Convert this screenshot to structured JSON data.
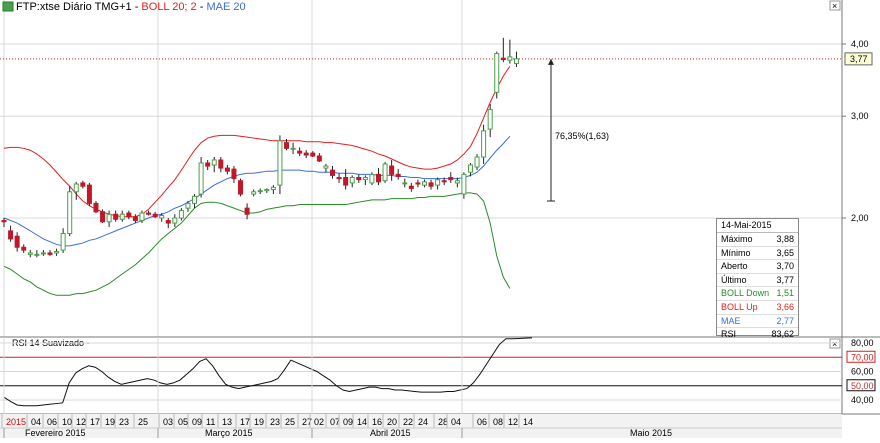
{
  "main_title": {
    "icon": "chart-settings-icon",
    "symbol": "FTP:xtse Diário TMG+1",
    "boll": "BOLL 20; 2",
    "mae": "MAE 20",
    "sep": "-"
  },
  "rsi_title": "RSI 14 Suavizado",
  "rsi_sep": "-",
  "close_icon": "close-icon",
  "colors": {
    "up": "#4aa04a",
    "down": "#c0182a",
    "boll_up": "#e02020",
    "boll_down": "#2a8a2a",
    "mae": "#3a6fd8",
    "grid": "#d8d8d8",
    "hline": "#e02020",
    "rsi": "#111111",
    "rsi70": "#d02020"
  },
  "main_axis": {
    "labels": [
      "4,00",
      "3,00",
      "2,00"
    ],
    "current": "3,77"
  },
  "rsi_axis": {
    "labels": [
      "80,00",
      "70,00",
      "60,00",
      "50,00",
      "40,00"
    ],
    "boxed": [
      "70,00",
      "50,00"
    ]
  },
  "annotation": "76,35%(1,63)",
  "info": {
    "date": "14-Mai-2015",
    "rows": [
      {
        "k": "Máximo",
        "v": "3,88",
        "color": "#000000"
      },
      {
        "k": "Mínimo",
        "v": "3,65",
        "color": "#000000"
      },
      {
        "k": "Aberto",
        "v": "3,70",
        "color": "#000000"
      },
      {
        "k": "Último",
        "v": "3,77",
        "color": "#000000"
      },
      {
        "k": "BOLL Down",
        "v": "1,51",
        "color": "#2a8a2a"
      },
      {
        "k": "BOLL Up",
        "v": "3,66",
        "color": "#e02020"
      },
      {
        "k": "MAE",
        "v": "2,77",
        "color": "#3a6fd8"
      },
      {
        "k": "RSI",
        "v": "83,62",
        "color": "#000000"
      }
    ]
  },
  "x_axis": {
    "days": [
      "2015",
      "04",
      "06",
      "10",
      "12",
      "17",
      "19",
      "23",
      "25",
      "03",
      "05",
      "09",
      "11",
      "13",
      "17",
      "19",
      "23",
      "25",
      "27",
      "02",
      "07",
      "09",
      "14",
      "16",
      "20",
      "22",
      "24",
      "28",
      "04",
      "06",
      "08",
      "12",
      "14"
    ],
    "months": [
      "Fevereiro 2015",
      "Março 2015",
      "Abril 2015",
      "Maio 2015"
    ]
  },
  "chart_data": {
    "type": "candlestick",
    "title": "FTP:xtse Diário TMG+1",
    "y_range": [
      1.0,
      4.3
    ],
    "y_ticks": [
      4.0,
      3.0,
      2.0
    ],
    "last_value": 3.77,
    "annotation": {
      "text": "76,35%(1,63)",
      "from": 2.14,
      "to": 3.77
    },
    "series": [
      {
        "name": "Candles",
        "ohlc": [
          [
            1.98,
            2.0,
            1.93,
            1.97
          ],
          [
            1.9,
            1.94,
            1.82,
            1.84
          ],
          [
            1.86,
            1.89,
            1.75,
            1.78
          ],
          [
            1.78,
            1.8,
            1.74,
            1.76
          ],
          [
            1.73,
            1.76,
            1.71,
            1.74
          ],
          [
            1.73,
            1.76,
            1.71,
            1.73
          ],
          [
            1.74,
            1.76,
            1.72,
            1.74
          ],
          [
            1.74,
            1.76,
            1.72,
            1.73
          ],
          [
            1.74,
            1.77,
            1.72,
            1.75
          ],
          [
            1.76,
            1.92,
            1.74,
            1.88
          ],
          [
            1.88,
            2.27,
            1.86,
            2.22
          ],
          [
            2.22,
            2.31,
            2.15,
            2.29
          ],
          [
            2.3,
            2.32,
            2.25,
            2.27
          ],
          [
            2.28,
            2.3,
            2.1,
            2.12
          ],
          [
            2.12,
            2.14,
            2.04,
            2.05
          ],
          [
            2.05,
            2.07,
            1.96,
            1.97
          ],
          [
            1.97,
            2.06,
            1.93,
            2.03
          ],
          [
            2.03,
            2.06,
            1.97,
            1.99
          ],
          [
            1.99,
            2.06,
            1.97,
            2.03
          ],
          [
            2.04,
            2.06,
            1.99,
            2.01
          ],
          [
            2.01,
            2.03,
            1.96,
            1.98
          ],
          [
            1.98,
            2.06,
            1.96,
            2.04
          ],
          [
            2.04,
            2.06,
            2.02,
            2.03
          ],
          [
            2.03,
            2.05,
            2.0,
            2.01
          ],
          [
            2.0,
            2.04,
            1.97,
            2.02
          ],
          [
            1.98,
            2.0,
            1.92,
            1.96
          ],
          [
            1.96,
            2.03,
            1.93,
            2.0
          ],
          [
            2.0,
            2.08,
            1.98,
            2.06
          ],
          [
            2.08,
            2.14,
            2.05,
            2.12
          ],
          [
            2.12,
            2.2,
            2.08,
            2.18
          ],
          [
            2.2,
            2.55,
            2.17,
            2.49
          ],
          [
            2.49,
            2.52,
            2.42,
            2.46
          ],
          [
            2.47,
            2.55,
            2.4,
            2.52
          ],
          [
            2.52,
            2.55,
            2.4,
            2.44
          ],
          [
            2.44,
            2.47,
            2.38,
            2.41
          ],
          [
            2.43,
            2.46,
            2.3,
            2.34
          ],
          [
            2.32,
            2.34,
            2.18,
            2.2
          ],
          [
            2.08,
            2.12,
            1.99,
            2.03
          ],
          [
            2.2,
            2.24,
            2.18,
            2.22
          ],
          [
            2.23,
            2.25,
            2.2,
            2.23
          ],
          [
            2.23,
            2.25,
            2.21,
            2.24
          ],
          [
            2.24,
            2.28,
            2.2,
            2.26
          ],
          [
            2.28,
            2.78,
            2.2,
            2.72
          ],
          [
            2.7,
            2.74,
            2.62,
            2.64
          ],
          [
            2.64,
            2.7,
            2.58,
            2.64
          ],
          [
            2.61,
            2.65,
            2.56,
            2.59
          ],
          [
            2.59,
            2.62,
            2.54,
            2.57
          ],
          [
            2.59,
            2.61,
            2.55,
            2.56
          ],
          [
            2.56,
            2.59,
            2.5,
            2.51
          ],
          [
            2.44,
            2.48,
            2.4,
            2.46
          ],
          [
            2.42,
            2.46,
            2.34,
            2.37
          ],
          [
            2.35,
            2.39,
            2.3,
            2.34
          ],
          [
            2.35,
            2.43,
            2.24,
            2.28
          ],
          [
            2.3,
            2.37,
            2.26,
            2.35
          ],
          [
            2.35,
            2.38,
            2.3,
            2.33
          ],
          [
            2.33,
            2.37,
            2.28,
            2.35
          ],
          [
            2.3,
            2.4,
            2.28,
            2.38
          ],
          [
            2.38,
            2.44,
            2.28,
            2.31
          ],
          [
            2.32,
            2.5,
            2.3,
            2.48
          ],
          [
            2.46,
            2.52,
            2.32,
            2.38
          ],
          [
            2.38,
            2.43,
            2.33,
            2.36
          ],
          [
            2.3,
            2.34,
            2.26,
            2.3
          ],
          [
            2.27,
            2.3,
            2.22,
            2.25
          ],
          [
            2.3,
            2.33,
            2.26,
            2.29
          ],
          [
            2.28,
            2.33,
            2.26,
            2.31
          ],
          [
            2.3,
            2.33,
            2.24,
            2.27
          ],
          [
            2.28,
            2.35,
            2.24,
            2.33
          ],
          [
            2.32,
            2.35,
            2.28,
            2.31
          ],
          [
            2.35,
            2.4,
            2.3,
            2.33
          ],
          [
            2.3,
            2.35,
            2.26,
            2.32
          ],
          [
            2.2,
            2.4,
            2.16,
            2.38
          ],
          [
            2.4,
            2.49,
            2.36,
            2.47
          ],
          [
            2.45,
            2.58,
            2.42,
            2.55
          ],
          [
            2.55,
            2.9,
            2.48,
            2.83
          ],
          [
            2.85,
            3.15,
            2.76,
            3.08
          ],
          [
            3.3,
            3.88,
            3.22,
            3.85
          ],
          [
            3.78,
            4.1,
            3.72,
            3.76
          ],
          [
            3.75,
            4.07,
            3.7,
            3.8
          ],
          [
            3.7,
            3.88,
            3.65,
            3.77
          ]
        ]
      },
      {
        "name": "BOLL Up",
        "values": [
          2.64,
          2.65,
          2.65,
          2.64,
          2.62,
          2.58,
          2.53,
          2.47,
          2.4,
          2.33,
          2.27,
          2.2,
          2.14,
          2.1,
          2.07,
          2.05,
          2.03,
          2.02,
          2.01,
          2.01,
          2.01,
          2.03,
          2.07,
          2.13,
          2.19,
          2.26,
          2.33,
          2.42,
          2.52,
          2.62,
          2.7,
          2.75,
          2.77,
          2.78,
          2.78,
          2.78,
          2.77,
          2.76,
          2.75,
          2.74,
          2.73,
          2.72,
          2.72,
          2.72,
          2.72,
          2.72,
          2.71,
          2.71,
          2.71,
          2.7,
          2.7,
          2.69,
          2.68,
          2.67,
          2.65,
          2.63,
          2.61,
          2.58,
          2.56,
          2.53,
          2.5,
          2.47,
          2.45,
          2.44,
          2.43,
          2.43,
          2.44,
          2.46,
          2.48,
          2.52,
          2.58,
          2.66,
          2.8,
          2.98,
          3.17,
          3.35,
          3.52,
          3.66
        ]
      },
      {
        "name": "BOLL Down",
        "values": [
          1.65,
          1.63,
          1.6,
          1.57,
          1.55,
          1.52,
          1.5,
          1.48,
          1.47,
          1.47,
          1.47,
          1.48,
          1.48,
          1.49,
          1.5,
          1.52,
          1.54,
          1.57,
          1.6,
          1.63,
          1.66,
          1.7,
          1.74,
          1.79,
          1.84,
          1.88,
          1.92,
          1.96,
          2.02,
          2.08,
          2.12,
          2.13,
          2.13,
          2.12,
          2.1,
          2.08,
          2.06,
          2.04,
          2.04,
          2.05,
          2.07,
          2.08,
          2.09,
          2.1,
          2.1,
          2.11,
          2.11,
          2.11,
          2.11,
          2.11,
          2.11,
          2.11,
          2.11,
          2.12,
          2.13,
          2.14,
          2.15,
          2.15,
          2.15,
          2.16,
          2.16,
          2.16,
          2.16,
          2.17,
          2.17,
          2.18,
          2.18,
          2.18,
          2.19,
          2.2,
          2.21,
          2.21,
          2.2,
          2.14,
          1.96,
          1.72,
          1.58,
          1.51
        ]
      },
      {
        "name": "MAE",
        "values": [
          2.0,
          1.98,
          1.96,
          1.93,
          1.9,
          1.87,
          1.84,
          1.82,
          1.8,
          1.79,
          1.79,
          1.8,
          1.81,
          1.83,
          1.84,
          1.86,
          1.88,
          1.9,
          1.92,
          1.94,
          1.96,
          1.98,
          2.0,
          2.02,
          2.03,
          2.05,
          2.08,
          2.1,
          2.13,
          2.16,
          2.2,
          2.24,
          2.28,
          2.31,
          2.34,
          2.36,
          2.38,
          2.39,
          2.39,
          2.4,
          2.41,
          2.41,
          2.42,
          2.42,
          2.42,
          2.42,
          2.41,
          2.41,
          2.4,
          2.4,
          2.4,
          2.39,
          2.39,
          2.39,
          2.38,
          2.38,
          2.38,
          2.37,
          2.37,
          2.37,
          2.36,
          2.36,
          2.35,
          2.35,
          2.34,
          2.34,
          2.34,
          2.34,
          2.34,
          2.34,
          2.35,
          2.37,
          2.4,
          2.46,
          2.54,
          2.62,
          2.69,
          2.77
        ]
      },
      {
        "name": "RSI 14 Suavizado",
        "values": [
          42.0,
          39.0,
          36.5,
          36.0,
          36.0,
          36.0,
          36.5,
          37.0,
          37.5,
          38.0,
          52.0,
          59.0,
          62.0,
          64.0,
          63.0,
          60.0,
          56.0,
          53.0,
          51.0,
          52.0,
          53.0,
          54.0,
          55.0,
          54.0,
          52.0,
          51.0,
          52.0,
          54.0,
          58.0,
          62.0,
          67.0,
          69.0,
          64.0,
          57.0,
          51.0,
          49.0,
          48.0,
          49.0,
          50.0,
          51.0,
          52.0,
          53.0,
          55.0,
          61.0,
          68.0,
          66.0,
          64.0,
          62.0,
          60.0,
          57.0,
          54.0,
          50.0,
          47.0,
          46.0,
          47.0,
          48.0,
          49.0,
          49.0,
          48.0,
          48.0,
          47.0,
          47.0,
          46.5,
          46.0,
          45.5,
          45.5,
          45.5,
          45.5,
          46.0,
          46.0,
          47.0,
          48.0,
          52.0,
          58.0,
          65.0,
          72.0,
          79.0,
          83.0,
          83.0,
          83.2,
          83.4,
          83.6
        ]
      }
    ]
  }
}
